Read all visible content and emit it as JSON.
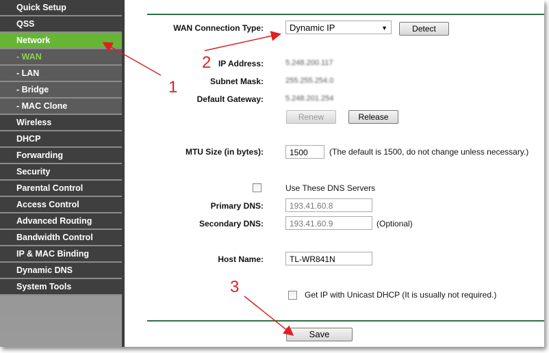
{
  "sidebar": {
    "items": [
      {
        "label": "Quick Setup"
      },
      {
        "label": "QSS"
      },
      {
        "label": "Network"
      },
      {
        "label": "- WAN"
      },
      {
        "label": "- LAN"
      },
      {
        "label": "- Bridge"
      },
      {
        "label": "- MAC Clone"
      },
      {
        "label": "Wireless"
      },
      {
        "label": "DHCP"
      },
      {
        "label": "Forwarding"
      },
      {
        "label": "Security"
      },
      {
        "label": "Parental Control"
      },
      {
        "label": "Access Control"
      },
      {
        "label": "Advanced Routing"
      },
      {
        "label": "Bandwidth Control"
      },
      {
        "label": "IP & MAC Binding"
      },
      {
        "label": "Dynamic DNS"
      },
      {
        "label": "System Tools"
      }
    ]
  },
  "form": {
    "wan_type_label": "WAN Connection Type:",
    "wan_type_value": "Dynamic IP",
    "detect": "Detect",
    "ip_label": "IP Address:",
    "ip_value": "5.248.200.117",
    "mask_label": "Subnet Mask:",
    "mask_value": "255.255.254.0",
    "gw_label": "Default Gateway:",
    "gw_value": "5.248.201.254",
    "renew": "Renew",
    "release": "Release",
    "mtu_label": "MTU Size (in bytes):",
    "mtu_value": "1500",
    "mtu_note": "(The default is 1500, do not change unless necessary.)",
    "dns_check": "Use These DNS Servers",
    "dns_checked": false,
    "pdns_label": "Primary DNS:",
    "pdns_value": "193.41.60.8",
    "sdns_label": "Secondary DNS:",
    "sdns_value": "193.41.60.9",
    "optional": "(Optional)",
    "host_label": "Host Name:",
    "host_value": "TL-WR841N",
    "unicast": "Get IP with Unicast DHCP (It is usually not required.)",
    "unicast_checked": false,
    "save": "Save"
  },
  "annotations": {
    "a1": "1",
    "a2": "2",
    "a3": "3",
    "color": "#e02020"
  }
}
